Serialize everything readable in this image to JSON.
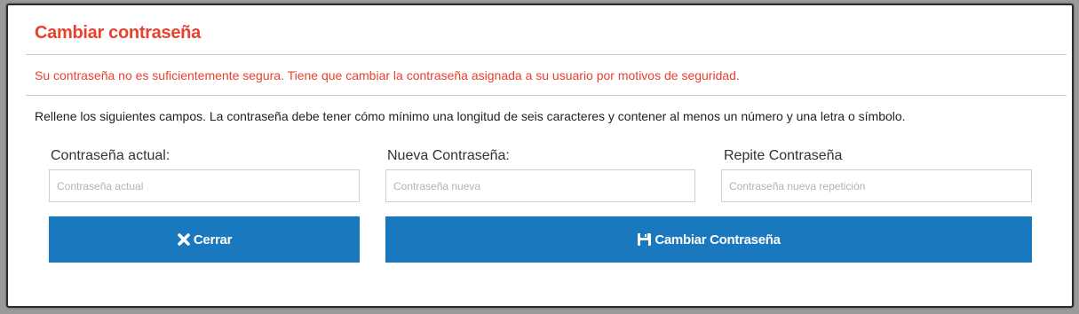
{
  "dialog": {
    "title": "Cambiar contraseña",
    "warning": "Su contraseña no es suficientemente segura. Tiene que cambiar la contraseña asignada a su usuario por motivos de seguridad.",
    "instructions": "Rellene los siguientes campos. La contraseña debe tener cómo mínimo una longitud de seis caracteres y contener al menos un número y una letra o símbolo."
  },
  "fields": {
    "current": {
      "label": "Contraseña actual:",
      "placeholder": "Contraseña actual",
      "value": ""
    },
    "new": {
      "label": "Nueva Contraseña:",
      "placeholder": "Contraseña nueva",
      "value": ""
    },
    "repeat": {
      "label": "Repite Contraseña",
      "placeholder": "Contraseña nueva repetición",
      "value": ""
    }
  },
  "buttons": {
    "close": {
      "label": "Cerrar",
      "icon": "close-x-icon"
    },
    "submit": {
      "label": "Cambiar Contraseña",
      "icon": "save-floppy-icon"
    }
  },
  "colors": {
    "accent_red": "#e8412f",
    "button_blue": "#1a78be"
  }
}
